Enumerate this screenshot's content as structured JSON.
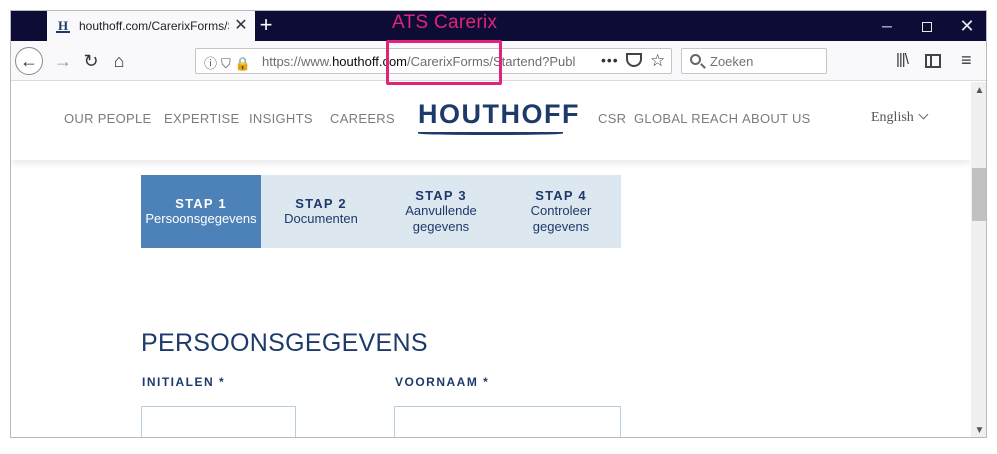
{
  "annotation": {
    "label": "ATS Carerix"
  },
  "browser": {
    "tab": {
      "favicon_letter": "H",
      "title": "houthoff.com/CarerixForms/Sta",
      "close": "✕"
    },
    "new_tab": "+",
    "window": {
      "minimize": "─",
      "close": "✕"
    },
    "nav": {
      "back": "←",
      "forward": "→",
      "reload": "↻",
      "home": "⌂"
    },
    "url": {
      "prefix": "https://www.",
      "domain": "houthoff.com",
      "path": "/CarerixForms/Startend?Publ",
      "icons": "ⓘ⛉",
      "lock": "🔒",
      "page_actions": "•••",
      "star": "☆"
    },
    "search": {
      "placeholder": "Zoeken"
    },
    "toolbar": {
      "library": "|||\\",
      "menu": "≡"
    }
  },
  "site": {
    "nav_left": [
      "OUR PEOPLE",
      "EXPERTISE",
      "INSIGHTS",
      "CAREERS"
    ],
    "logo": "HOUTHOFF",
    "nav_right": [
      "CSR",
      "GLOBAL REACH",
      "ABOUT US"
    ],
    "language": "English"
  },
  "steps": [
    {
      "num": "STAP 1",
      "label": "Persoonsgegevens",
      "active": true
    },
    {
      "num": "STAP 2",
      "label": "Documenten",
      "active": false
    },
    {
      "num": "STAP 3",
      "label": "Aanvullende gegevens",
      "active": false
    },
    {
      "num": "STAP 4",
      "label": "Controleer gegevens",
      "active": false
    }
  ],
  "form": {
    "title": "PERSOONSGEGEVENS",
    "fields": [
      {
        "label": "INITIALEN *",
        "value": ""
      },
      {
        "label": "VOORNAAM *",
        "value": ""
      }
    ]
  },
  "scrollbar": {
    "up": "▲",
    "down": "▼"
  },
  "colors": {
    "brand": "#1e3a6b",
    "active_step": "#4d82b8",
    "inactive_step": "#dde7ef",
    "annotation": "#e0247a",
    "tabbar": "#0c0c36"
  }
}
